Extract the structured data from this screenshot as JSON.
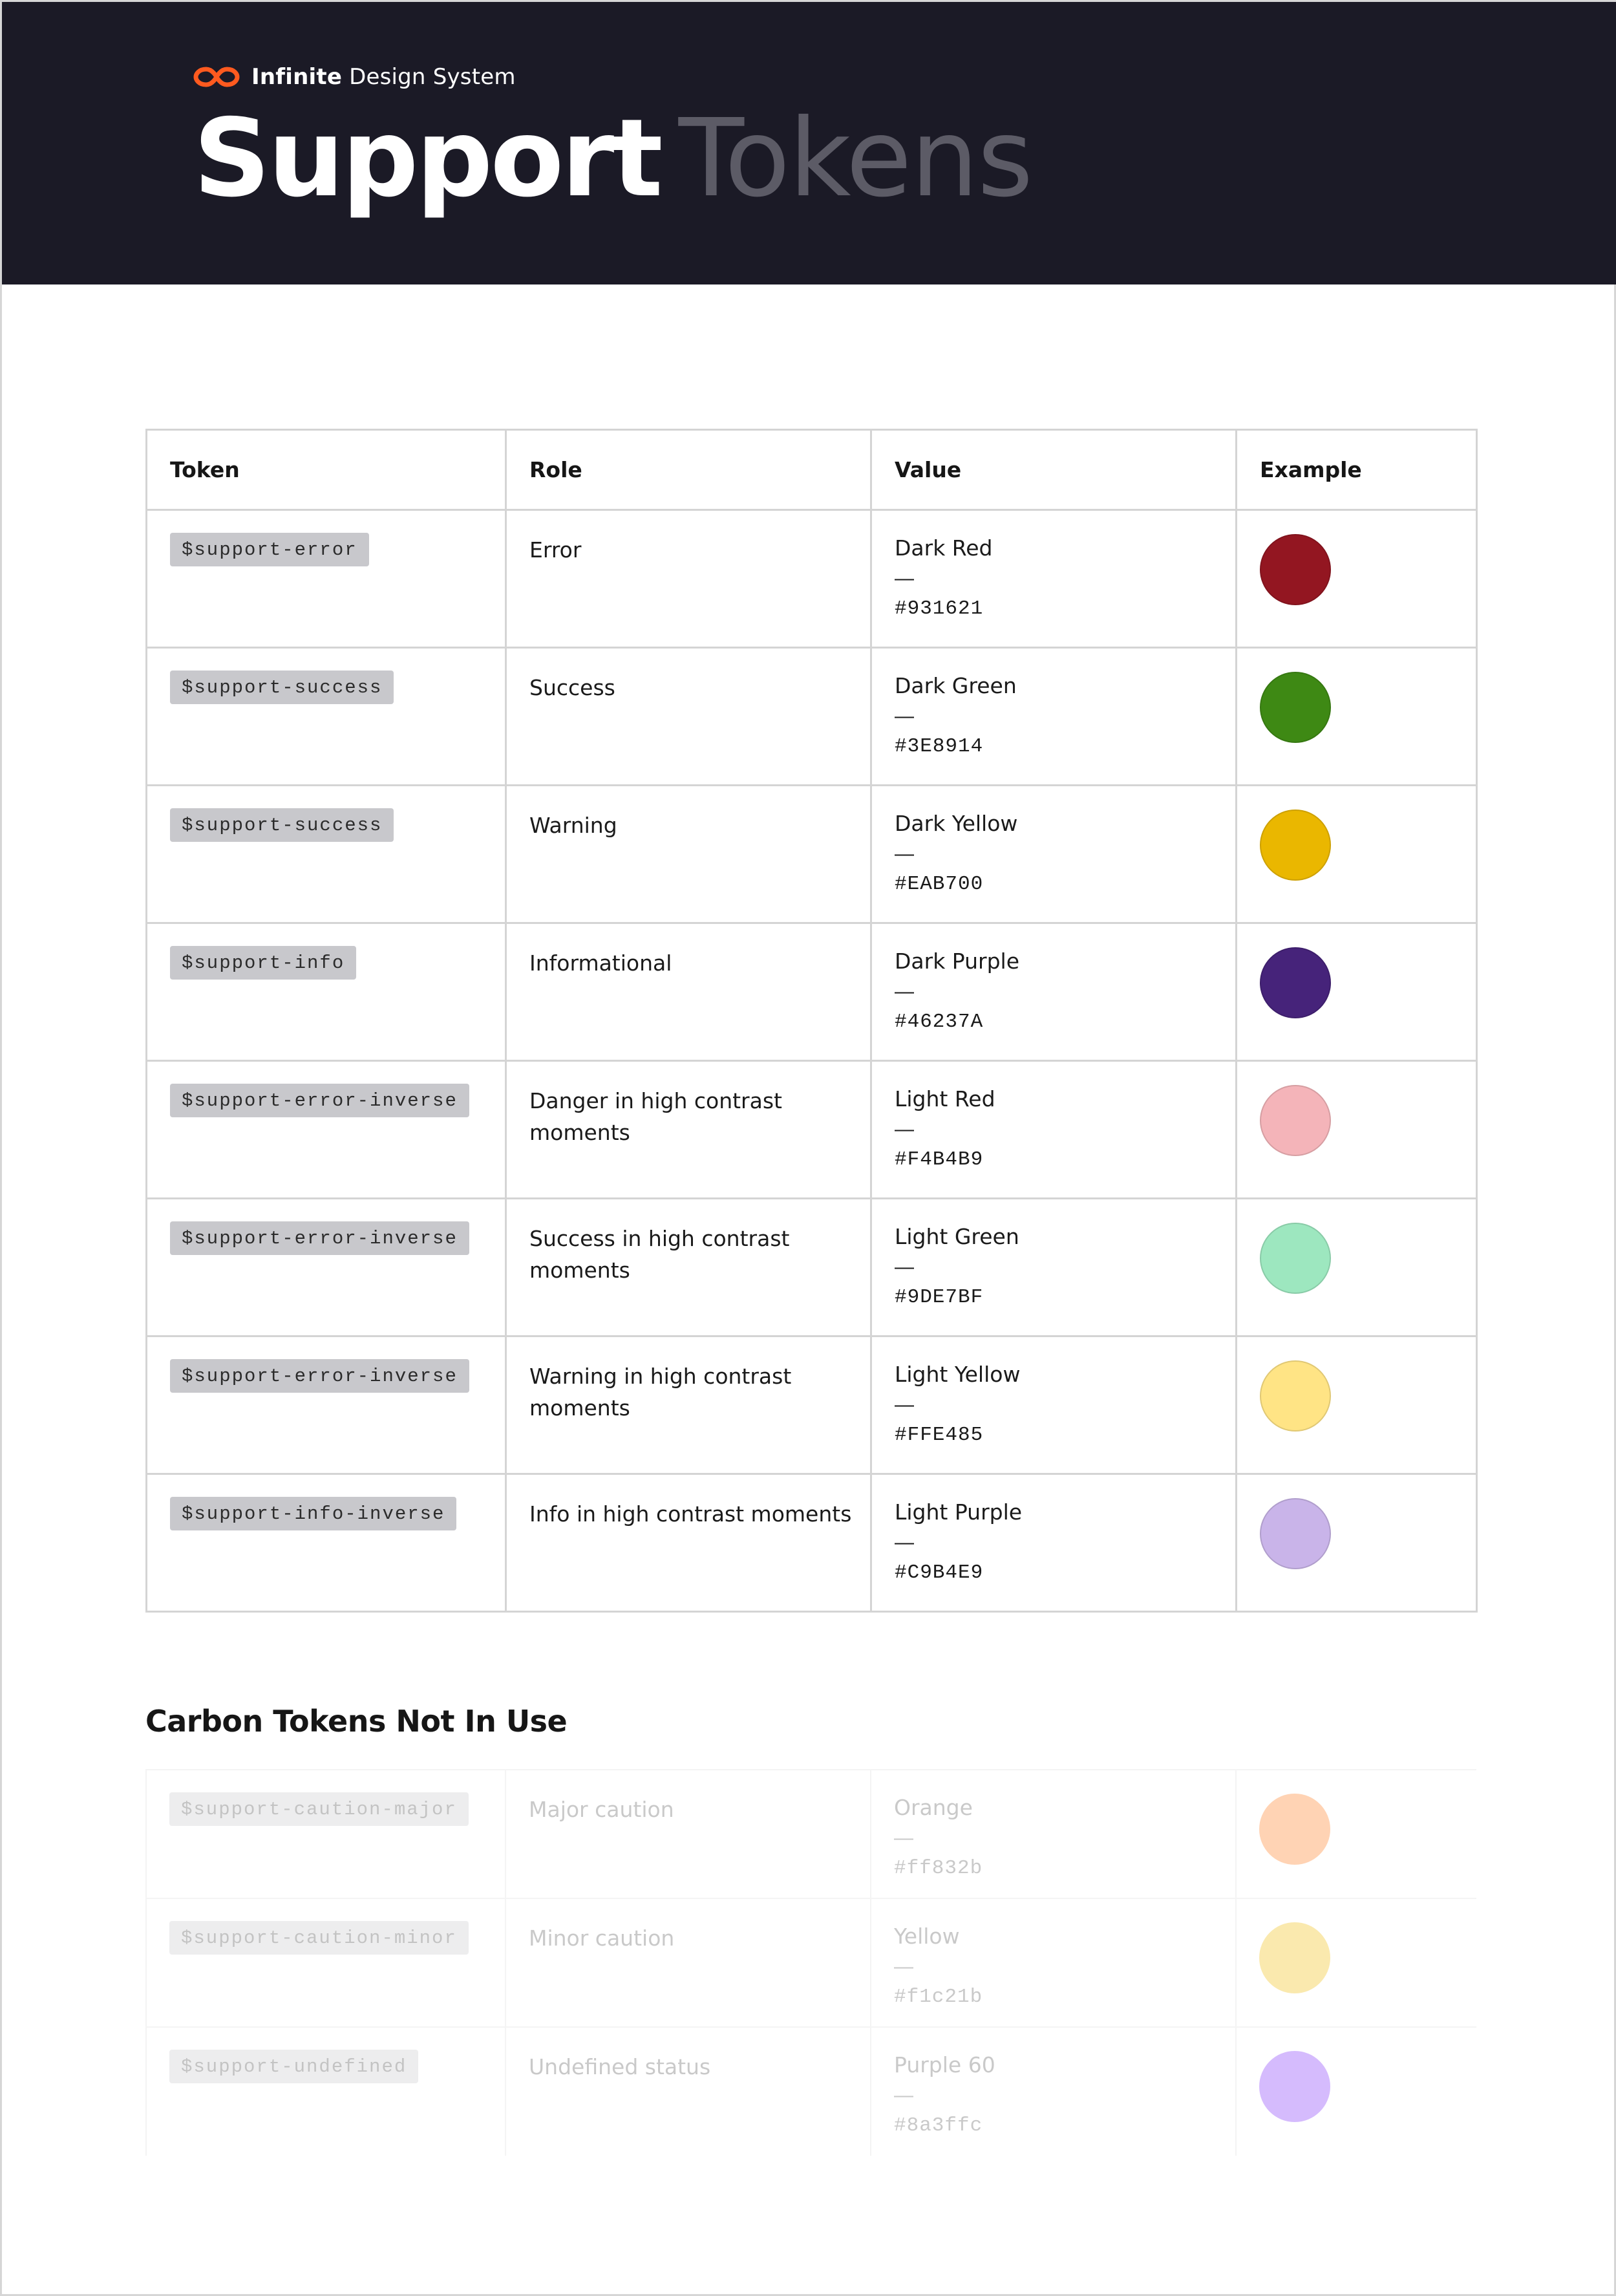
{
  "brand": {
    "name_bold": "Infinite",
    "name_rest": "Design System",
    "logo_icon": "infinity-icon",
    "logo_color": "#ff5a1f"
  },
  "title": {
    "strong": "Support",
    "light": "Tokens"
  },
  "table": {
    "headers": {
      "token": "Token",
      "role": "Role",
      "value": "Value",
      "example": "Example"
    },
    "rows": [
      {
        "token": "$support-error",
        "role": "Error",
        "value_name": "Dark Red",
        "dash": "—",
        "hex": "#931621",
        "color": "#931621"
      },
      {
        "token": "$support-success",
        "role": "Success",
        "value_name": "Dark Green",
        "dash": "—",
        "hex": "#3E8914",
        "color": "#3E8914"
      },
      {
        "token": "$support-success",
        "role": "Warning",
        "value_name": "Dark Yellow",
        "dash": "—",
        "hex": "#EAB700",
        "color": "#EAB700"
      },
      {
        "token": "$support-info",
        "role": "Informational",
        "value_name": "Dark Purple",
        "dash": "—",
        "hex": "#46237A",
        "color": "#46237A"
      },
      {
        "token": "$support-error-inverse",
        "role": "Danger in high contrast moments",
        "value_name": "Light Red",
        "dash": "—",
        "hex": "#F4B4B9",
        "color": "#F4B4B9"
      },
      {
        "token": "$support-error-inverse",
        "role": "Success in high contrast moments",
        "value_name": "Light Green",
        "dash": "—",
        "hex": "#9DE7BF",
        "color": "#9DE7BF"
      },
      {
        "token": "$support-error-inverse",
        "role": "Warning in high contrast moments",
        "value_name": "Light Yellow",
        "dash": "—",
        "hex": "#FFE485",
        "color": "#FFE485"
      },
      {
        "token": "$support-info-inverse",
        "role": "Info in high contrast moments",
        "value_name": "Light Purple",
        "dash": "—",
        "hex": "#C9B4E9",
        "color": "#C9B4E9"
      }
    ]
  },
  "unused": {
    "heading": "Carbon Tokens Not In Use",
    "rows": [
      {
        "token": "$support-caution-major",
        "role": "Major caution",
        "value_name": "Orange",
        "dash": "—",
        "hex": "#ff832b",
        "color": "#ff832b"
      },
      {
        "token": "$support-caution-minor",
        "role": "Minor caution",
        "value_name": "Yellow",
        "dash": "—",
        "hex": "#f1c21b",
        "color": "#f1c21b"
      },
      {
        "token": "$support-undefined",
        "role": "Undefined status",
        "value_name": "Purple 60",
        "dash": "—",
        "hex": "#8a3ffc",
        "color": "#8a3ffc"
      }
    ]
  }
}
